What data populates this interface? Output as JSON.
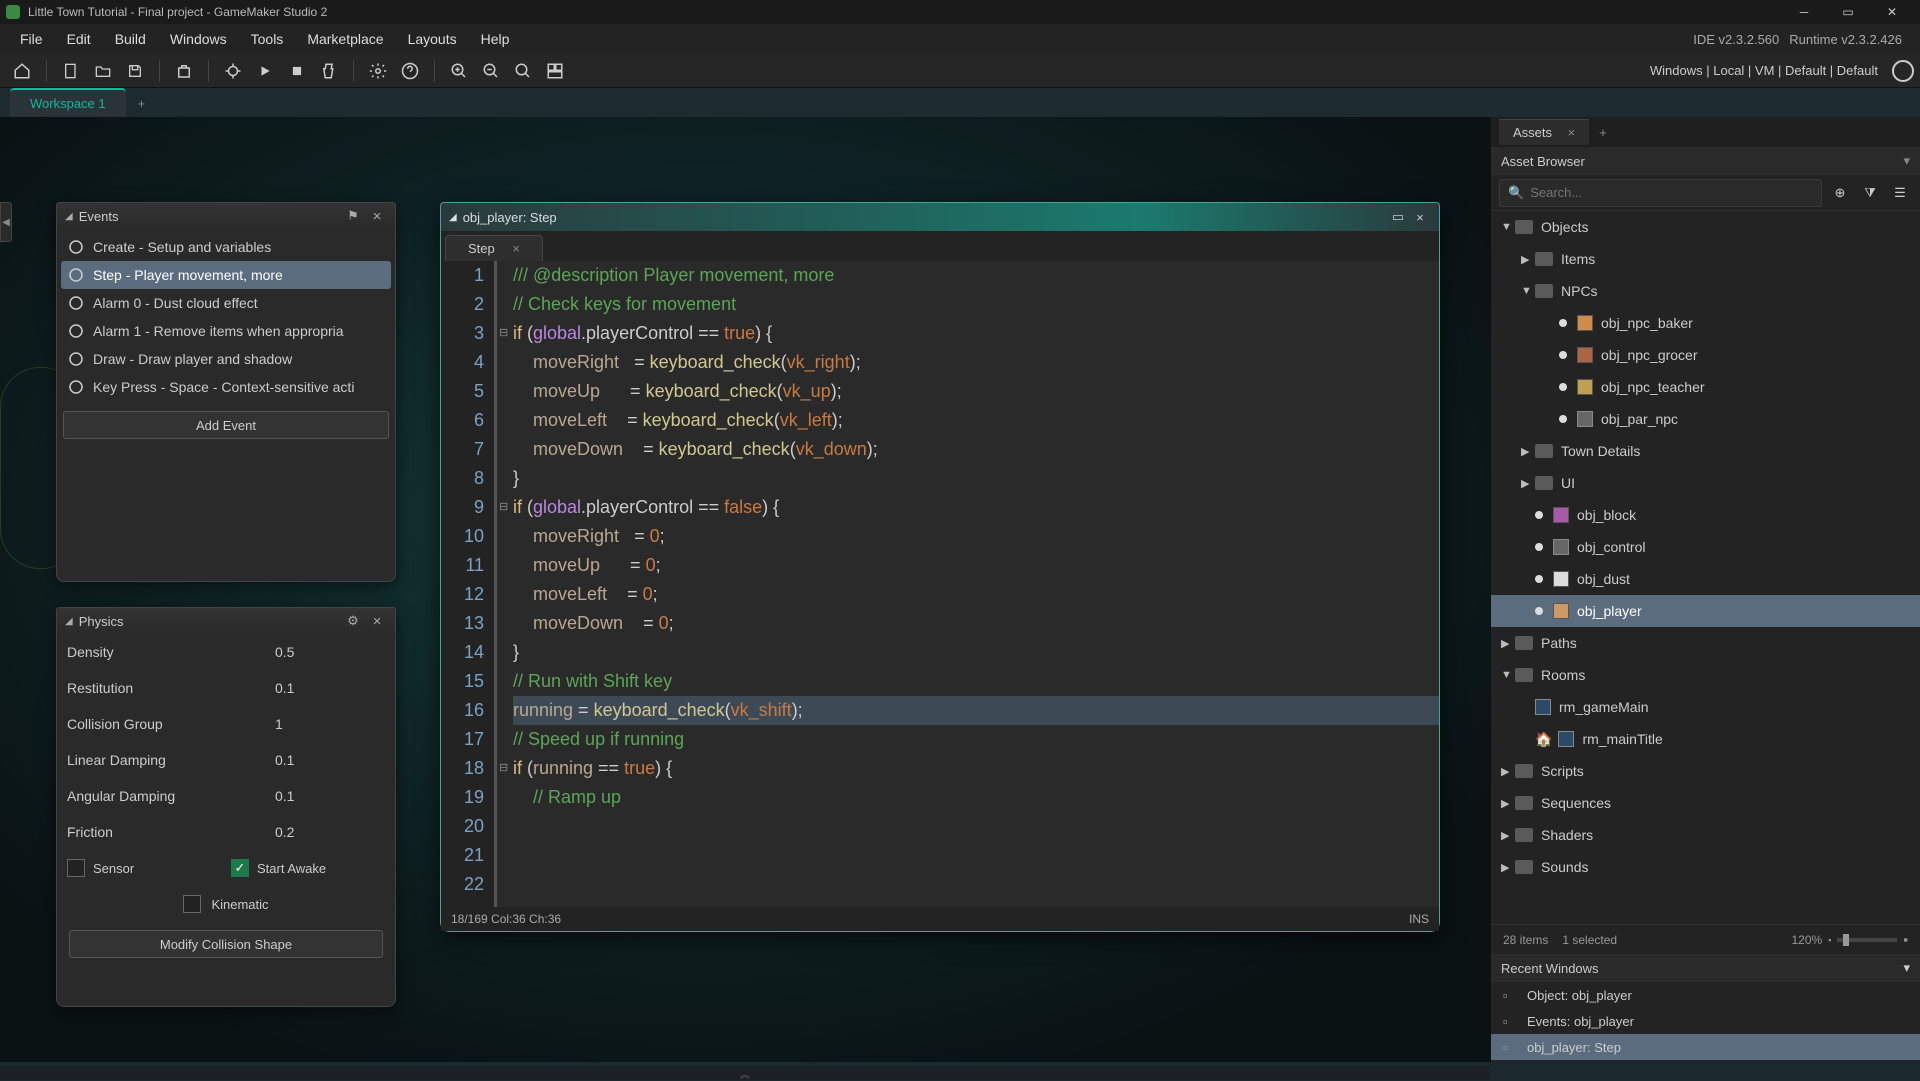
{
  "title": "Little Town Tutorial - Final project - GameMaker Studio 2",
  "menu": {
    "items": [
      "File",
      "Edit",
      "Build",
      "Windows",
      "Tools",
      "Marketplace",
      "Layouts",
      "Help"
    ],
    "ide_version": "IDE v2.3.2.560",
    "runtime_version": "Runtime v2.3.2.426"
  },
  "toolbar_right": "Windows | Local | VM | Default | Default",
  "workspace": {
    "tab": "Workspace 1"
  },
  "events_panel": {
    "title": "Events",
    "items": [
      "Create - Setup and variables",
      "Step - Player movement, more",
      "Alarm 0 - Dust cloud effect",
      "Alarm 1 - Remove items when appropria",
      "Draw - Draw player and shadow",
      "Key Press - Space - Context-sensitive acti"
    ],
    "selected_index": 1,
    "add_button": "Add Event"
  },
  "physics_panel": {
    "title": "Physics",
    "props": [
      {
        "label": "Density",
        "value": "0.5"
      },
      {
        "label": "Restitution",
        "value": "0.1"
      },
      {
        "label": "Collision Group",
        "value": "1"
      },
      {
        "label": "Linear Damping",
        "value": "0.1"
      },
      {
        "label": "Angular Damping",
        "value": "0.1"
      },
      {
        "label": "Friction",
        "value": "0.2"
      }
    ],
    "sensor": "Sensor",
    "start_awake": "Start Awake",
    "kinematic": "Kinematic",
    "modify": "Modify Collision Shape"
  },
  "code_panel": {
    "title": "obj_player: Step",
    "tab": "Step",
    "status_left": "18/169 Col:36 Ch:36",
    "status_right": "INS"
  },
  "assets": {
    "tab": "Assets",
    "browser_label": "Asset Browser",
    "search_placeholder": "Search...",
    "status": {
      "items": "28 items",
      "selected": "1 selected",
      "zoom": "120%"
    }
  },
  "recent": {
    "title": "Recent Windows",
    "items": [
      "Object: obj_player",
      "Events: obj_player",
      "obj_player: Step"
    ],
    "selected_index": 2
  },
  "tree": {
    "lines": [
      {
        "lvl": 0,
        "arrow": "▼",
        "type": "folder",
        "label": "Objects"
      },
      {
        "lvl": 1,
        "arrow": "▶",
        "type": "folder",
        "label": "Items"
      },
      {
        "lvl": 1,
        "arrow": "▼",
        "type": "folder",
        "label": "NPCs"
      },
      {
        "lvl": 2,
        "arrow": "",
        "type": "obj",
        "label": "obj_npc_baker",
        "color": "#d08a4a"
      },
      {
        "lvl": 2,
        "arrow": "",
        "type": "obj",
        "label": "obj_npc_grocer",
        "color": "#aa6644"
      },
      {
        "lvl": 2,
        "arrow": "",
        "type": "obj",
        "label": "obj_npc_teacher",
        "color": "#c0a050"
      },
      {
        "lvl": 2,
        "arrow": "",
        "type": "parobj",
        "label": "obj_par_npc"
      },
      {
        "lvl": 1,
        "arrow": "▶",
        "type": "folder",
        "label": "Town Details"
      },
      {
        "lvl": 1,
        "arrow": "▶",
        "type": "folder",
        "label": "UI"
      },
      {
        "lvl": 1,
        "arrow": "",
        "type": "obj",
        "label": "obj_block",
        "color": "#a85aa8"
      },
      {
        "lvl": 1,
        "arrow": "",
        "type": "parobj",
        "label": "obj_control"
      },
      {
        "lvl": 1,
        "arrow": "",
        "type": "obj",
        "label": "obj_dust",
        "color": "#dddddd"
      },
      {
        "lvl": 1,
        "arrow": "",
        "type": "obj",
        "label": "obj_player",
        "color": "#cc9966",
        "sel": true
      },
      {
        "lvl": 0,
        "arrow": "▶",
        "type": "folder",
        "label": "Paths"
      },
      {
        "lvl": 0,
        "arrow": "▼",
        "type": "folder",
        "label": "Rooms"
      },
      {
        "lvl": 1,
        "arrow": "",
        "type": "room",
        "label": "rm_gameMain"
      },
      {
        "lvl": 1,
        "arrow": "",
        "type": "roomhome",
        "label": "rm_mainTitle"
      },
      {
        "lvl": 0,
        "arrow": "▶",
        "type": "folder",
        "label": "Scripts"
      },
      {
        "lvl": 0,
        "arrow": "▶",
        "type": "folder",
        "label": "Sequences"
      },
      {
        "lvl": 0,
        "arrow": "▶",
        "type": "folder",
        "label": "Shaders"
      },
      {
        "lvl": 0,
        "arrow": "▶",
        "type": "folder",
        "label": "Sounds"
      }
    ]
  },
  "code_lines": [
    {
      "n": 1,
      "html": "<span class='c-comment'>/// @description Player movement, more</span>"
    },
    {
      "n": 2,
      "html": "<span class='c-comment'>// Check keys for movement</span>"
    },
    {
      "n": 3,
      "fold": true,
      "html": "<span class='c-kw'>if</span> (<span class='c-global'>global</span>.playerControl == <span class='c-true'>true</span>) {"
    },
    {
      "n": 4,
      "html": "    <span class='c-ident'>moveRight</span>   = <span class='c-func'>keyboard_check</span>(<span class='c-const'>vk_right</span>);"
    },
    {
      "n": 5,
      "html": "    <span class='c-ident'>moveUp</span>      = <span class='c-func'>keyboard_check</span>(<span class='c-const'>vk_up</span>);"
    },
    {
      "n": 6,
      "html": "    <span class='c-ident'>moveLeft</span>    = <span class='c-func'>keyboard_check</span>(<span class='c-const'>vk_left</span>);"
    },
    {
      "n": 7,
      "html": "    <span class='c-ident'>moveDown</span>    = <span class='c-func'>keyboard_check</span>(<span class='c-const'>vk_down</span>);"
    },
    {
      "n": 8,
      "html": "}"
    },
    {
      "n": 9,
      "html": ""
    },
    {
      "n": 10,
      "fold": true,
      "html": "<span class='c-kw'>if</span> (<span class='c-global'>global</span>.playerControl == <span class='c-true'>false</span>) {"
    },
    {
      "n": 11,
      "html": "    <span class='c-ident'>moveRight</span>   = <span class='c-num'>0</span>;"
    },
    {
      "n": 12,
      "html": "    <span class='c-ident'>moveUp</span>      = <span class='c-num'>0</span>;"
    },
    {
      "n": 13,
      "html": "    <span class='c-ident'>moveLeft</span>    = <span class='c-num'>0</span>;"
    },
    {
      "n": 14,
      "html": "    <span class='c-ident'>moveDown</span>    = <span class='c-num'>0</span>;"
    },
    {
      "n": 15,
      "html": "}"
    },
    {
      "n": 16,
      "html": ""
    },
    {
      "n": 17,
      "html": "<span class='c-comment'>// Run with Shift key</span>"
    },
    {
      "n": 18,
      "hl": true,
      "html": "<span class='c-ident'>running</span> = <span class='c-func'>keyboard_check</span>(<span class='c-const'>vk_shift</span>);"
    },
    {
      "n": 19,
      "html": ""
    },
    {
      "n": 20,
      "html": "<span class='c-comment'>// Speed up if running</span>"
    },
    {
      "n": 21,
      "fold": true,
      "html": "<span class='c-kw'>if</span> (<span class='c-ident'>running</span> == <span class='c-true'>true</span>) {"
    },
    {
      "n": 22,
      "html": "    <span class='c-comment'>// Ramp up</span>"
    }
  ]
}
